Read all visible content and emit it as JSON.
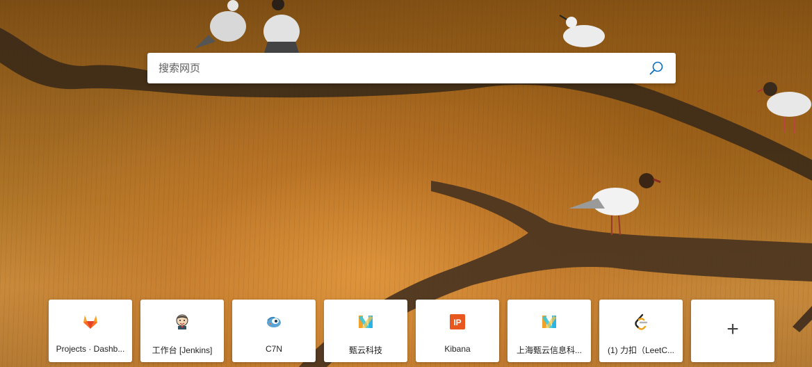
{
  "search": {
    "placeholder": "搜索网页",
    "icon": "search-icon",
    "accent_color": "#0a6dc2"
  },
  "quick_links": [
    {
      "label": "Projects · Dashb...",
      "icon": "gitlab-icon"
    },
    {
      "label": "工作台 [Jenkins]",
      "icon": "jenkins-icon"
    },
    {
      "label": "C7N",
      "icon": "c7n-icon"
    },
    {
      "label": "甄云科技",
      "icon": "zhenyun-icon"
    },
    {
      "label": "Kibana",
      "icon": "kibana-icon"
    },
    {
      "label": "上海甄云信息科...",
      "icon": "zhenyun-icon"
    },
    {
      "label": "(1) 力扣（LeetC...",
      "icon": "leetcode-icon"
    }
  ],
  "add_tile": {
    "label": "+",
    "icon": "plus-icon"
  }
}
